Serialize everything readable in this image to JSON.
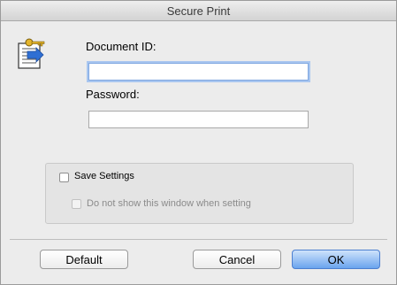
{
  "window": {
    "title": "Secure Print"
  },
  "form": {
    "document_id_label": "Document ID:",
    "document_id_value": "",
    "password_label": "Password:",
    "password_value": ""
  },
  "options": {
    "save_settings_label": "Save Settings",
    "save_settings_checked": false,
    "do_not_show_label": "Do not show this window when setting",
    "do_not_show_checked": false
  },
  "buttons": {
    "default_label": "Default",
    "cancel_label": "Cancel",
    "ok_label": "OK"
  },
  "icons": {
    "secure_print": "secure-print-key-document-icon"
  },
  "colors": {
    "focus_ring": "#a9c6f0",
    "default_button": "#6aa4ee"
  }
}
